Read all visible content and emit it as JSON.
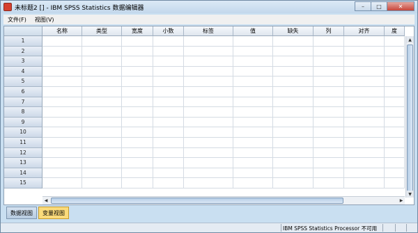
{
  "window": {
    "title": "未标题2 [] - IBM SPSS Statistics 数据编辑器"
  },
  "controls": {
    "minimize": "–",
    "maximize": "□",
    "close": "✕"
  },
  "menu": [
    "文件(F)",
    "视图(V)"
  ],
  "columns": [
    "名称",
    "类型",
    "宽度",
    "小数",
    "标签",
    "值",
    "缺失",
    "列",
    "对齐",
    "度"
  ],
  "rows": [
    "1",
    "2",
    "3",
    "4",
    "5",
    "6",
    "7",
    "8",
    "9",
    "10",
    "11",
    "12",
    "13",
    "14",
    "15"
  ],
  "tabs": [
    {
      "label": "数据视图",
      "active": false
    },
    {
      "label": "变量视图",
      "active": true
    }
  ],
  "status": {
    "text": "IBM SPSS Statistics Processor 不可用"
  },
  "colors": {
    "active_tab": "#fbdb7b",
    "window_frame": "#c9dff1",
    "header": "#dfe6ef"
  },
  "icons": {
    "app": "spss-app-icon",
    "scroll_up": "arrow-up-icon",
    "scroll_down": "arrow-down-icon",
    "scroll_left": "arrow-left-icon",
    "scroll_right": "arrow-right-icon"
  }
}
